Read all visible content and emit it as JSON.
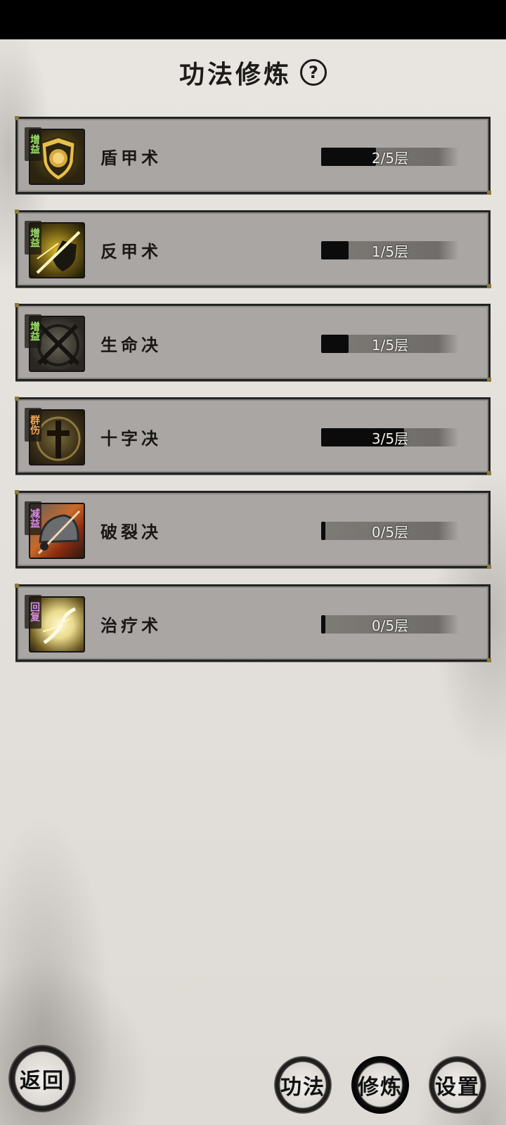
{
  "header": {
    "title": "功法修炼",
    "help_symbol": "?"
  },
  "skills": [
    {
      "tag": "增益",
      "tag_color": "green",
      "name": "盾甲术",
      "progress_label": "2/5层",
      "level": 2,
      "max": 5,
      "icon": "lion-shield-icon"
    },
    {
      "tag": "增益",
      "tag_color": "green",
      "name": "反甲术",
      "progress_label": "1/5层",
      "level": 1,
      "max": 5,
      "icon": "reflect-shield-icon"
    },
    {
      "tag": "增益",
      "tag_color": "green",
      "name": "生命决",
      "progress_label": "1/5层",
      "level": 1,
      "max": 5,
      "icon": "crossed-swords-icon"
    },
    {
      "tag": "群伤",
      "tag_color": "orange",
      "name": "十字决",
      "progress_label": "3/5层",
      "level": 3,
      "max": 5,
      "icon": "cross-icon"
    },
    {
      "tag": "减益",
      "tag_color": "purple",
      "name": "破裂决",
      "progress_label": "0/5层",
      "level": 0,
      "max": 5,
      "icon": "broken-helmet-icon"
    },
    {
      "tag": "回复",
      "tag_color": "purple",
      "name": "治疗术",
      "progress_label": "0/5层",
      "level": 0,
      "max": 5,
      "icon": "healing-light-icon"
    }
  ],
  "footer": {
    "back_label": "返回",
    "tabs": [
      "功法",
      "修炼",
      "设置"
    ],
    "active_tab": "修炼"
  },
  "colors": {
    "tag_green": "#9be36b",
    "tag_orange": "#f0a75a",
    "tag_purple": "#d78ae8",
    "bar_fill": "#0b0b0b",
    "card_bg": "#a9a6a3"
  }
}
